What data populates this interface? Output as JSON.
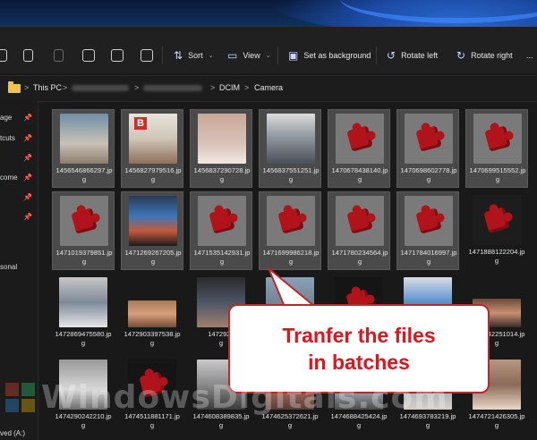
{
  "toolbar": {
    "sort_label": "Sort",
    "view_label": "View",
    "set_background_label": "Set as background",
    "rotate_left_label": "Rotate left",
    "rotate_right_label": "Rotate right",
    "more_label": "..."
  },
  "address": {
    "crumbs": [
      "This PC",
      "DCIM",
      "Camera"
    ],
    "separator": ">"
  },
  "sidebar": {
    "items": [
      "age",
      "tcuts",
      "come",
      "sonal",
      "ved (A:)"
    ]
  },
  "callout": {
    "line1": "Tranfer the files",
    "line2": "in batches"
  },
  "watermark": {
    "text": "WindowsDigitals.com"
  },
  "files": {
    "row1": [
      {
        "name": "1456546866297.jp",
        "ext": "g"
      },
      {
        "name": "1456827979516.jp",
        "ext": "g"
      },
      {
        "name": "1456837290728.jp",
        "ext": "g"
      },
      {
        "name": "1456837551251.jp",
        "ext": "g"
      },
      {
        "name": "1470678438140.jp",
        "ext": "g"
      },
      {
        "name": "1470698602778.jp",
        "ext": "g"
      },
      {
        "name": "1470699515552.jp",
        "ext": "g"
      }
    ],
    "row2": [
      {
        "name": "1471019379851.jp",
        "ext": "g"
      },
      {
        "name": "1471269267205.jp",
        "ext": "g"
      },
      {
        "name": "1471535142931.jp",
        "ext": "g"
      },
      {
        "name": "1471699986218.jp",
        "ext": "g"
      },
      {
        "name": "1471780234564.jp",
        "ext": "g"
      },
      {
        "name": "1471784016997.jp",
        "ext": "g"
      },
      {
        "name": "1471888122204.jp",
        "ext": "g"
      }
    ],
    "row3": [
      {
        "name": "1472869475580.jp",
        "ext": "g"
      },
      {
        "name": "1472903397538.jp",
        "ext": "g"
      },
      {
        "name": "1472926",
        "ext": "g"
      },
      {
        "name": "1474042251014.jp",
        "ext": "g"
      }
    ],
    "row4": [
      {
        "name": "1474290242210.jp",
        "ext": "g"
      },
      {
        "name": "1474511881171.jp",
        "ext": "g"
      },
      {
        "name": "1474608389835.jp",
        "ext": "g"
      },
      {
        "name": "1474625372621.jp",
        "ext": "g"
      },
      {
        "name": "1474688425424.jp",
        "ext": "g"
      },
      {
        "name": "1474693783219.jp",
        "ext": "g"
      },
      {
        "name": "1474721426305.jp",
        "ext": "g"
      }
    ]
  }
}
